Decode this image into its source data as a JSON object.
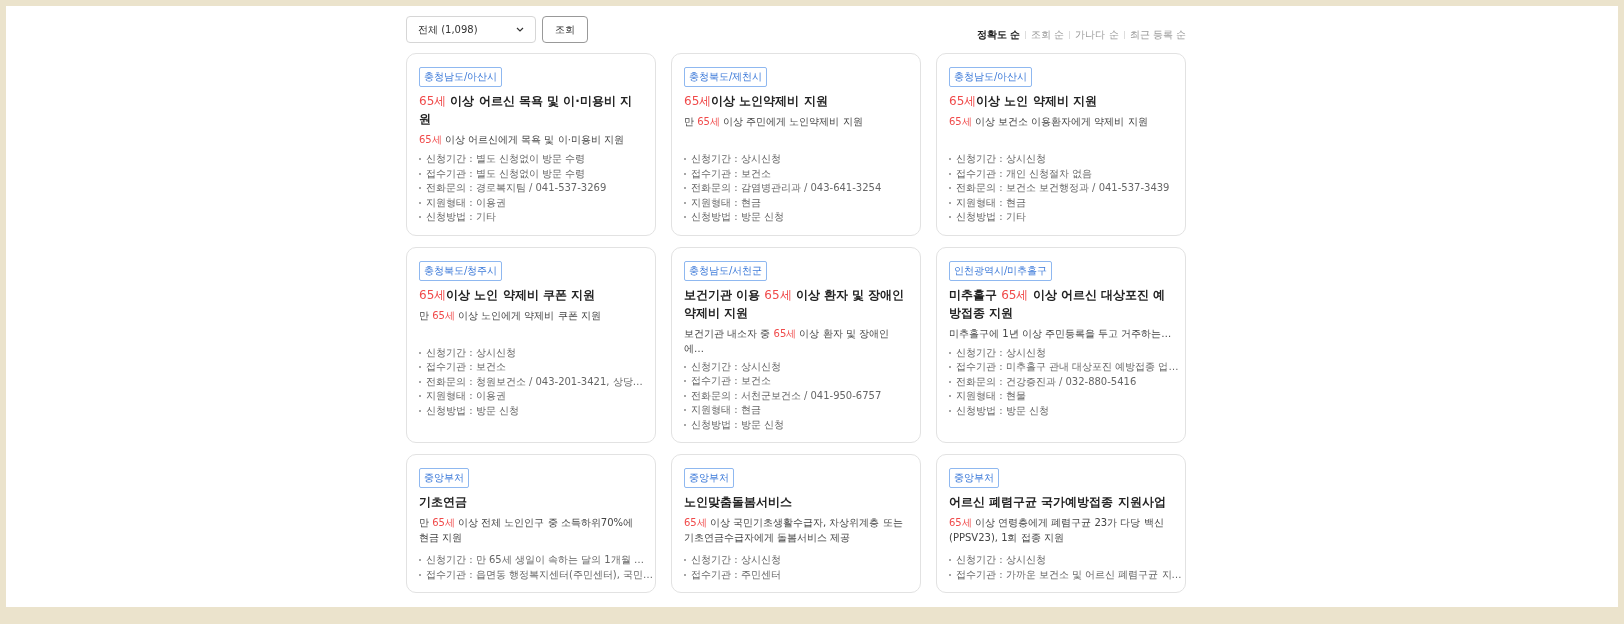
{
  "filter": {
    "value": "전체 (1,098)",
    "button": "조회"
  },
  "sort": [
    {
      "label": "정확도 순",
      "selected": true
    },
    {
      "label": "조회 순",
      "selected": false
    },
    {
      "label": "가나다 순",
      "selected": false
    },
    {
      "label": "최근 등록 순",
      "selected": false
    }
  ],
  "cards": [
    {
      "tag": "충청남도/아산시",
      "title": [
        {
          "text": "65세",
          "highlight": true
        },
        {
          "text": " 이상 어르신 목욕 및 이·미용비 지원",
          "highlight": false
        }
      ],
      "description": [
        {
          "text": "65세",
          "highlight": true
        },
        {
          "text": " 이상 어르신에게 목욕 및 이·미용비 지원",
          "highlight": false
        }
      ],
      "details": [
        "신청기간 : 별도 신청없이 방문 수령",
        "접수기관 : 별도 신청없이 방문 수령",
        "전화문의 : 경로복지팀 / 041-537-3269",
        "지원형태 : 이용권",
        "신청방법 : 기타"
      ]
    },
    {
      "tag": "충청북도/제천시",
      "title": [
        {
          "text": "65세",
          "highlight": true
        },
        {
          "text": "이상 노인약제비 지원",
          "highlight": false
        }
      ],
      "description": [
        {
          "text": "만 ",
          "highlight": false
        },
        {
          "text": "65세",
          "highlight": true
        },
        {
          "text": " 이상 주민에게 노인약제비 지원",
          "highlight": false
        }
      ],
      "details": [
        "신청기간 : 상시신청",
        "접수기관 : 보건소",
        "전화문의 : 감염병관리과 / 043-641-3254",
        "지원형태 : 현금",
        "신청방법 : 방문 신청"
      ]
    },
    {
      "tag": "충청남도/아산시",
      "title": [
        {
          "text": "65세",
          "highlight": true
        },
        {
          "text": "이상 노인 약제비 지원",
          "highlight": false
        }
      ],
      "description": [
        {
          "text": "65세",
          "highlight": true
        },
        {
          "text": " 이상 보건소 이용환자에게 약제비 지원",
          "highlight": false
        }
      ],
      "details": [
        "신청기간 : 상시신청",
        "접수기관 : 개인 신청절차 없음",
        "전화문의 : 보건소 보건행정과 / 041-537-3439",
        "지원형태 : 현금",
        "신청방법 : 기타"
      ]
    },
    {
      "tag": "충청북도/청주시",
      "title": [
        {
          "text": "65세",
          "highlight": true
        },
        {
          "text": "이상 노인 약제비 쿠폰 지원",
          "highlight": false
        }
      ],
      "description": [
        {
          "text": "만 ",
          "highlight": false
        },
        {
          "text": "65세",
          "highlight": true
        },
        {
          "text": " 이상 노인에게 약제비 쿠폰 지원",
          "highlight": false
        }
      ],
      "details": [
        "신청기간 : 상시신청",
        "접수기관 : 보건소",
        "전화문의 : 청원보건소 / 043-201-3421, 상당…",
        "지원형태 : 이용권",
        "신청방법 : 방문 신청"
      ]
    },
    {
      "tag": "충청남도/서천군",
      "title": [
        {
          "text": "보건기관 이용 ",
          "highlight": false
        },
        {
          "text": "65세",
          "highlight": true
        },
        {
          "text": " 이상 환자 및 장애인 약제비 지원",
          "highlight": false
        }
      ],
      "description": [
        {
          "text": "보건기관 내소자 중 ",
          "highlight": false
        },
        {
          "text": "65세",
          "highlight": true
        },
        {
          "text": " 이상 환자 및 장애인에…",
          "highlight": false
        }
      ],
      "details": [
        "신청기간 : 상시신청",
        "접수기관 : 보건소",
        "전화문의 : 서천군보건소 / 041-950-6757",
        "지원형태 : 현금",
        "신청방법 : 방문 신청"
      ]
    },
    {
      "tag": "인천광역시/미추홀구",
      "title": [
        {
          "text": "미추홀구 ",
          "highlight": false
        },
        {
          "text": "65세",
          "highlight": true
        },
        {
          "text": " 이상 어르신 대상포진 예방접종 지원",
          "highlight": false
        }
      ],
      "description": [
        {
          "text": "미추홀구에 1년 이상 주민등록을 두고 거주하는…",
          "highlight": false
        }
      ],
      "details": [
        "신청기간 : 상시신청",
        "접수기관 : 미추홀구 관내 대상포진 예방접종 업…",
        "전화문의 : 건강증진과 / 032-880-5416",
        "지원형태 : 현물",
        "신청방법 : 방문 신청"
      ]
    },
    {
      "tag": "중앙부처",
      "title": [
        {
          "text": "기초연금",
          "highlight": false
        }
      ],
      "description": [
        {
          "text": "만 ",
          "highlight": false
        },
        {
          "text": "65세",
          "highlight": true
        },
        {
          "text": " 이상 전체 노인인구 중 소득하위70%에 현금 지원",
          "highlight": false
        }
      ],
      "details": [
        "신청기간 : 만 65세 생일이 속하는 달의 1개월 …",
        "접수기관 : 읍면동 행정복지센터(주민센터), 국민…"
      ]
    },
    {
      "tag": "중앙부처",
      "title": [
        {
          "text": "노인맞춤돌봄서비스",
          "highlight": false
        }
      ],
      "description": [
        {
          "text": "65세",
          "highlight": true
        },
        {
          "text": " 이상 국민기초생활수급자, 차상위계층 또는 기초연금수급자에게 돌봄서비스 제공",
          "highlight": false
        }
      ],
      "details": [
        "신청기간 : 상시신청",
        "접수기관 : 주민센터"
      ]
    },
    {
      "tag": "중앙부처",
      "title": [
        {
          "text": "어르신 폐렴구균 국가예방접종 지원사업",
          "highlight": false
        }
      ],
      "description": [
        {
          "text": "65세",
          "highlight": true
        },
        {
          "text": " 이상 연령층에게 폐렴구균 23가 다당 백신 (PPSV23), 1회 접종 지원",
          "highlight": false
        }
      ],
      "details": [
        "신청기간 : 상시신청",
        "접수기관 : 가까운 보건소 및 어르신 폐렴구균 지…"
      ]
    }
  ]
}
